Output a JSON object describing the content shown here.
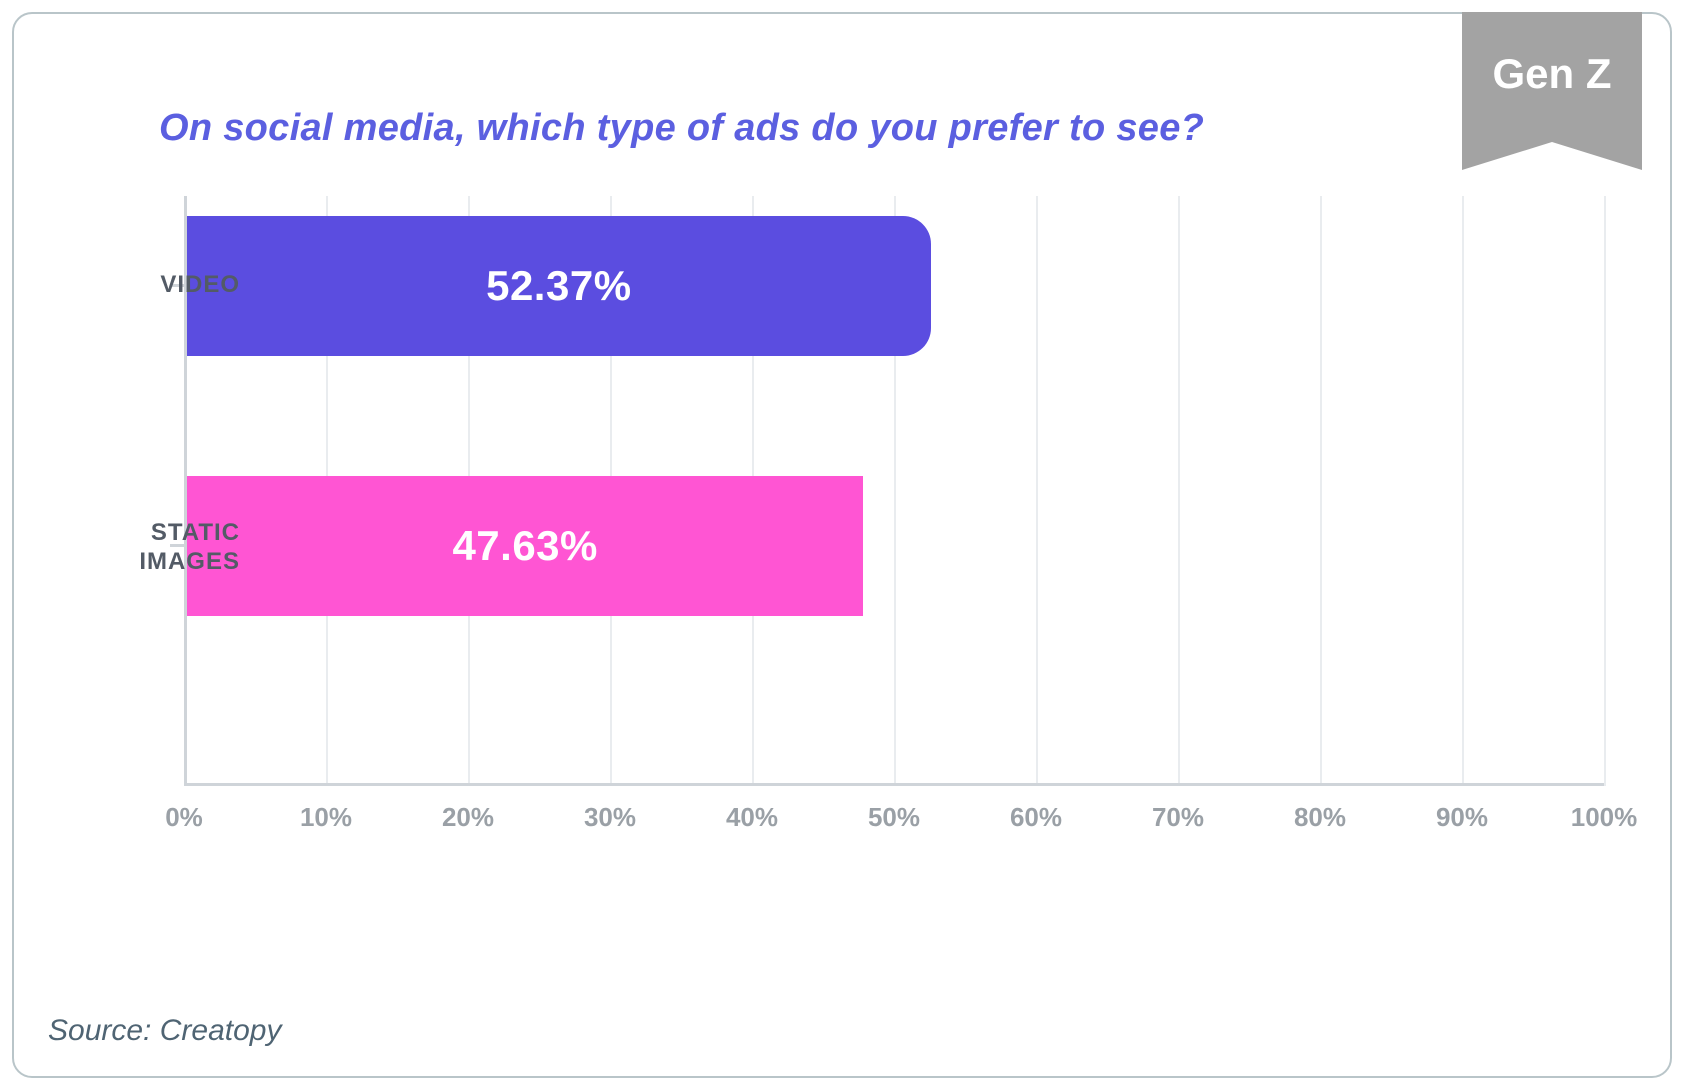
{
  "badge": {
    "text": "Gen Z"
  },
  "source_line": "Source: Creatopy",
  "chart_data": {
    "type": "bar",
    "title": "On social media, which type of ads do you prefer to see?",
    "orientation": "horizontal",
    "categories": [
      "VIDEO",
      "STATIC IMAGES"
    ],
    "values": [
      52.37,
      47.63
    ],
    "value_labels": [
      "52.37%",
      "47.63%"
    ],
    "colors": [
      "#5b4de0",
      "#ff55d3"
    ],
    "xlabel": "",
    "ylabel": "",
    "xlim": [
      0,
      100
    ],
    "x_ticks": [
      0,
      10,
      20,
      30,
      40,
      50,
      60,
      70,
      80,
      90,
      100
    ],
    "x_tick_labels": [
      "0%",
      "10%",
      "20%",
      "30%",
      "40%",
      "50%",
      "60%",
      "70%",
      "80%",
      "90%",
      "100%"
    ],
    "grid": true
  }
}
